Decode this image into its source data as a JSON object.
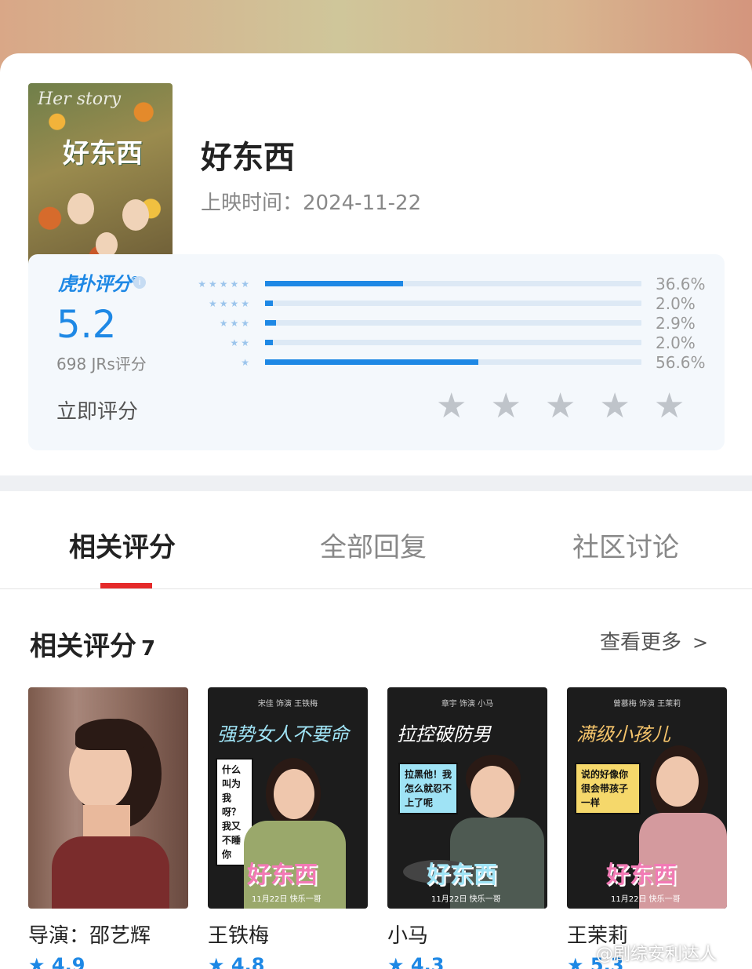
{
  "movie": {
    "poster_hertitle": "Her story",
    "poster_title": "好东西",
    "title": "好东西",
    "release_label": "上映时间：",
    "release_date": "2024-11-22"
  },
  "rating": {
    "logo_text": "虎扑评分",
    "info_icon": "i",
    "score": "5.2",
    "votes": "698 JRs评分",
    "rate_now": "立即评分",
    "distribution": [
      {
        "stars": 5,
        "percent": 36.6,
        "label": "36.6%"
      },
      {
        "stars": 4,
        "percent": 2.0,
        "label": "2.0%"
      },
      {
        "stars": 3,
        "percent": 2.9,
        "label": "2.9%"
      },
      {
        "stars": 2,
        "percent": 2.0,
        "label": "2.0%"
      },
      {
        "stars": 1,
        "percent": 56.6,
        "label": "56.6%"
      }
    ],
    "input_stars": 5
  },
  "tabs": [
    {
      "label": "相关评分",
      "active": true
    },
    {
      "label": "全部回复",
      "active": false
    },
    {
      "label": "社区讨论",
      "active": false
    }
  ],
  "section": {
    "title": "相关评分",
    "count": "7",
    "more": "查看更多"
  },
  "people": [
    {
      "name": "导演：邵艺辉",
      "rating": "★ 4.9"
    },
    {
      "name": "王铁梅",
      "rating": "★ 4.8",
      "credit": "宋佳 饰演 王铁梅",
      "slogan": "强势女人不要命",
      "bubble": "什么叫为我呀？我又不睡你",
      "logo": "好东西",
      "date": "11月22日 快乐一哥"
    },
    {
      "name": "小马",
      "rating": "★ 4.3",
      "credit": "章宇 饰演 小马",
      "slogan": "拉控破防男",
      "bubble": "拉黑他！我怎么就忍不上了呢",
      "logo": "好东西",
      "date": "11月22日 快乐一哥"
    },
    {
      "name": "王茉莉",
      "rating": "★ 5.3",
      "credit": "曾慕梅 饰演 王茉莉",
      "slogan": "满级小孩儿",
      "bubble": "说的好像你很会带孩子一样",
      "logo": "好东西",
      "date": "11月22日 快乐一哥"
    }
  ],
  "watermark": "@剧综安利达人",
  "colors": {
    "accent": "#1e88e5",
    "tab_indicator": "#e52a2a",
    "star_inactive": "#bfc4ca"
  }
}
